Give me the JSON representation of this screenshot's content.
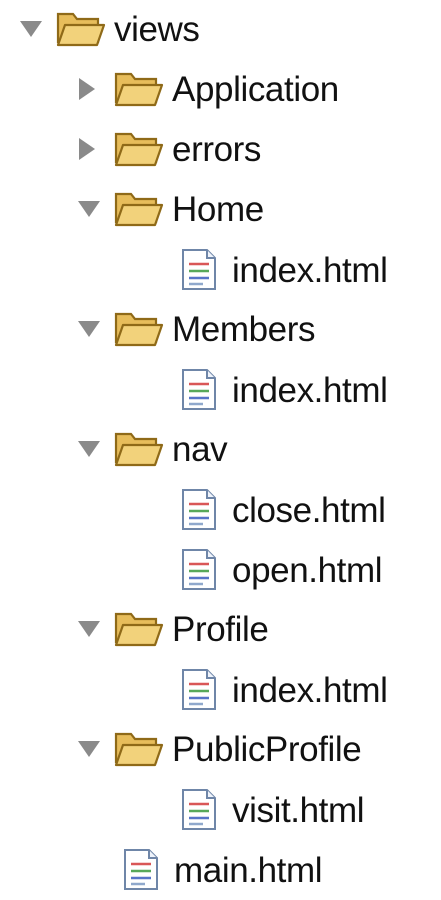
{
  "tree": {
    "items": [
      {
        "label": "views",
        "type": "folder",
        "state": "expanded"
      },
      {
        "label": "Application",
        "type": "folder",
        "state": "collapsed"
      },
      {
        "label": "errors",
        "type": "folder",
        "state": "collapsed"
      },
      {
        "label": "Home",
        "type": "folder",
        "state": "expanded"
      },
      {
        "label": "index.html",
        "type": "file"
      },
      {
        "label": "Members",
        "type": "folder",
        "state": "expanded"
      },
      {
        "label": "index.html",
        "type": "file"
      },
      {
        "label": "nav",
        "type": "folder",
        "state": "expanded"
      },
      {
        "label": "close.html",
        "type": "file"
      },
      {
        "label": "open.html",
        "type": "file"
      },
      {
        "label": "Profile",
        "type": "folder",
        "state": "expanded"
      },
      {
        "label": "index.html",
        "type": "file"
      },
      {
        "label": "PublicProfile",
        "type": "folder",
        "state": "expanded"
      },
      {
        "label": "visit.html",
        "type": "file"
      },
      {
        "label": "main.html",
        "type": "file"
      }
    ]
  },
  "icons": {
    "expanded_toggle": "triangle-down-icon",
    "collapsed_toggle": "triangle-right-icon",
    "folder": "folder-open-icon",
    "file": "html-file-icon"
  },
  "colors": {
    "folder_fill": "#f2d27b",
    "folder_stroke": "#8f6a18",
    "toggle": "#8a8a8a",
    "file_stroke": "#6f86a8",
    "file_red": "#d95757",
    "file_green": "#57a85a",
    "file_blue": "#5875c8"
  }
}
